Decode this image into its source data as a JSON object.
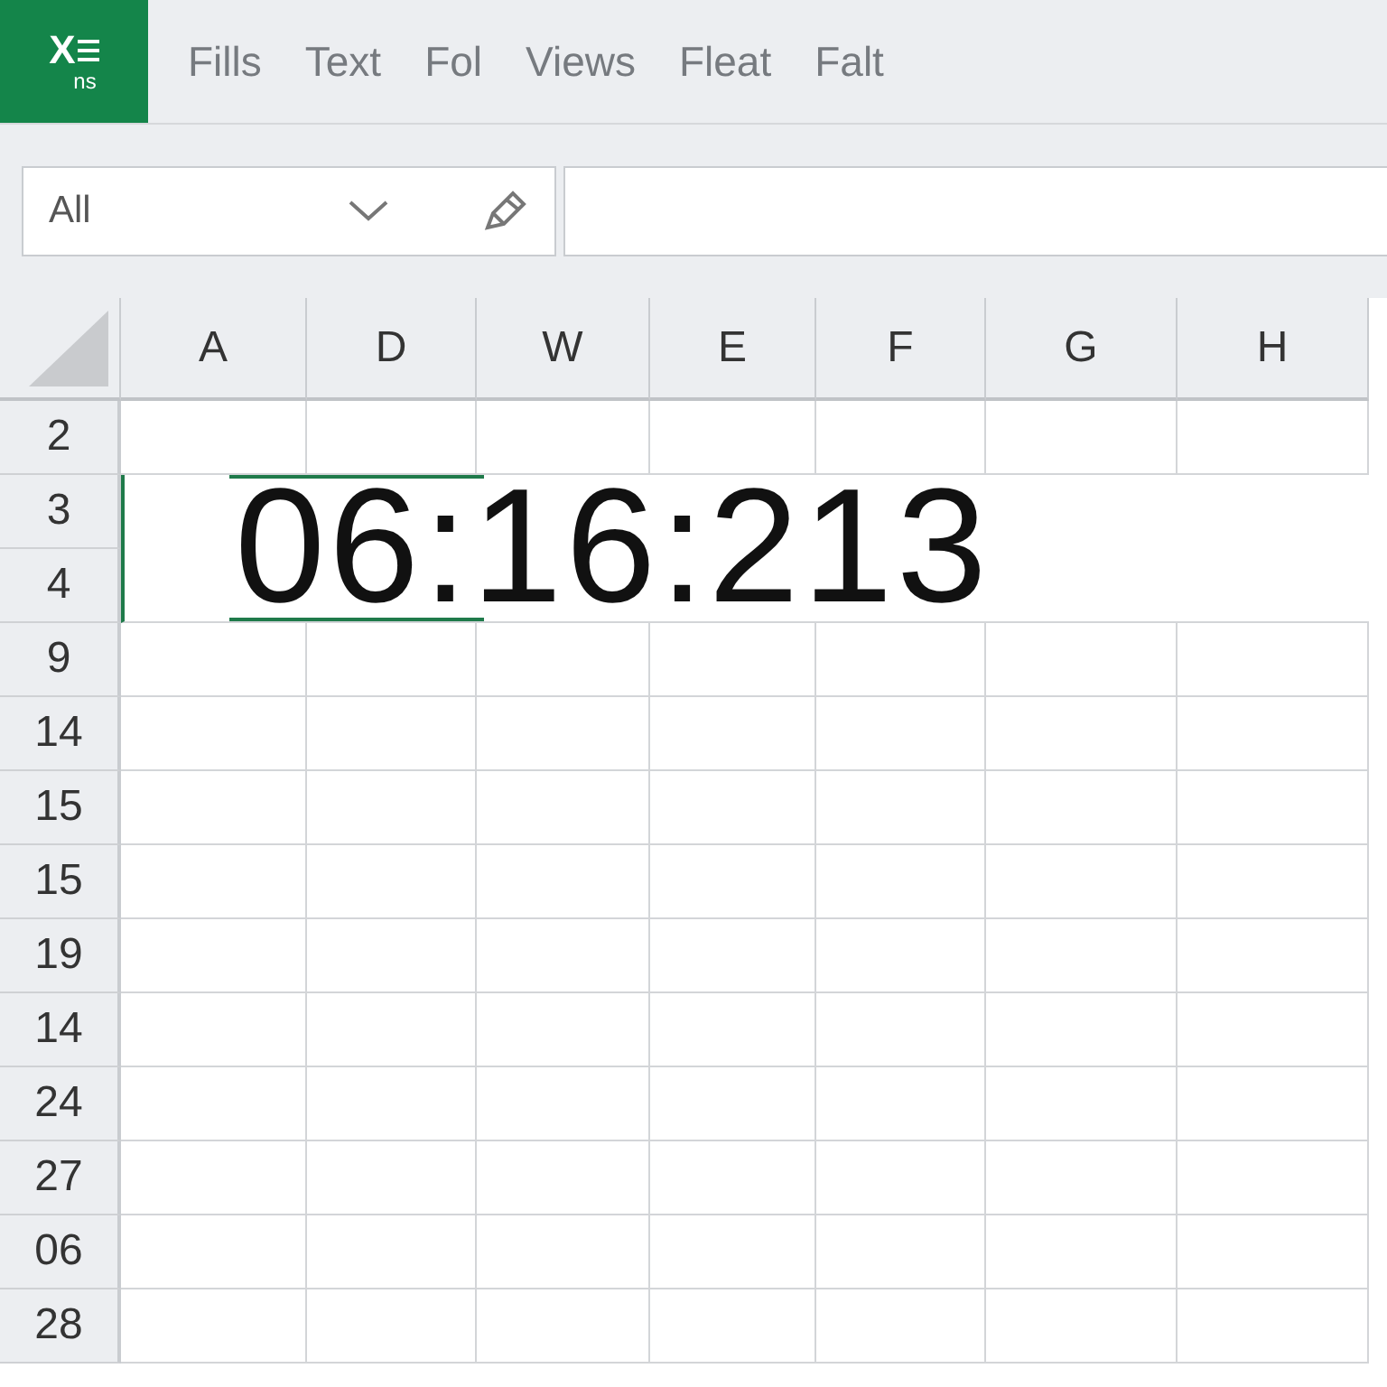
{
  "app_logo": {
    "letter": "X",
    "subtext": "ns"
  },
  "menu": [
    "Fills",
    "Text",
    "Fol",
    "Views",
    "Fleat",
    "Falt"
  ],
  "name_box": {
    "value": "All"
  },
  "columns": [
    "A",
    "D",
    "W",
    "E",
    "F",
    "G",
    "H"
  ],
  "rows": [
    "2",
    "3",
    "4",
    "9",
    "14",
    "15",
    "15",
    "19",
    "14",
    "24",
    "27",
    "06",
    "28"
  ],
  "merged_cell": {
    "value": "06:16:213",
    "selected": true
  }
}
